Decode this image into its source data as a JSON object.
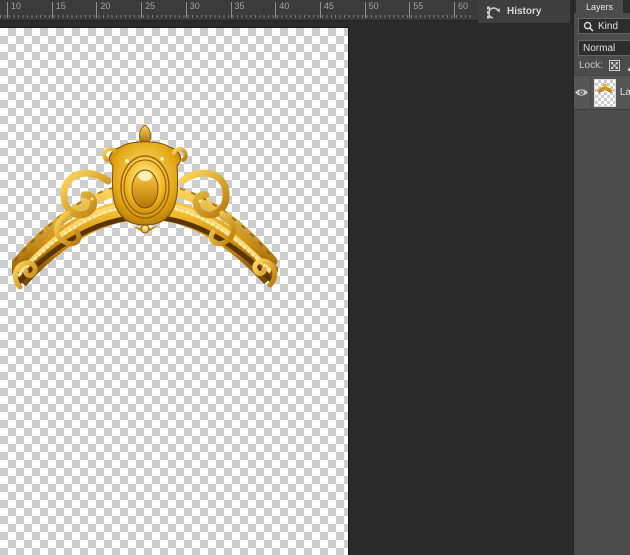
{
  "ruler": {
    "unit_numbers": [
      "10",
      "15",
      "20",
      "25",
      "30",
      "35",
      "40",
      "45",
      "50",
      "55",
      "60"
    ]
  },
  "history_panel_tab": {
    "label": "History"
  },
  "layers_panel": {
    "tab_label": "Layers",
    "search_filter": {
      "label": "Kind"
    },
    "blend_mode_value": "Normal",
    "lock_label": "Lock:",
    "layers": [
      {
        "name": "La",
        "visible": true
      }
    ]
  },
  "canvas": {
    "content": "gold-ornate-arch-ornament",
    "background": "transparent-checkerboard"
  },
  "icons": {
    "history": "history-icon",
    "search": "magnifier-icon",
    "lock_transparency": "checkerboard-icon",
    "lock_paint": "brush-icon",
    "visibility": "eye-icon"
  },
  "colors": {
    "gold_accent": "#d6930d",
    "gold_highlight": "#ffe08a",
    "panel_bg": "#4c4c4c",
    "pasteboard_bg": "#2a2a2a",
    "ruler_bg": "#3b3b3b",
    "field_bg": "#2d2d2d",
    "checker_gray": "#cdcdcd",
    "text_light": "#e2e2e2"
  }
}
